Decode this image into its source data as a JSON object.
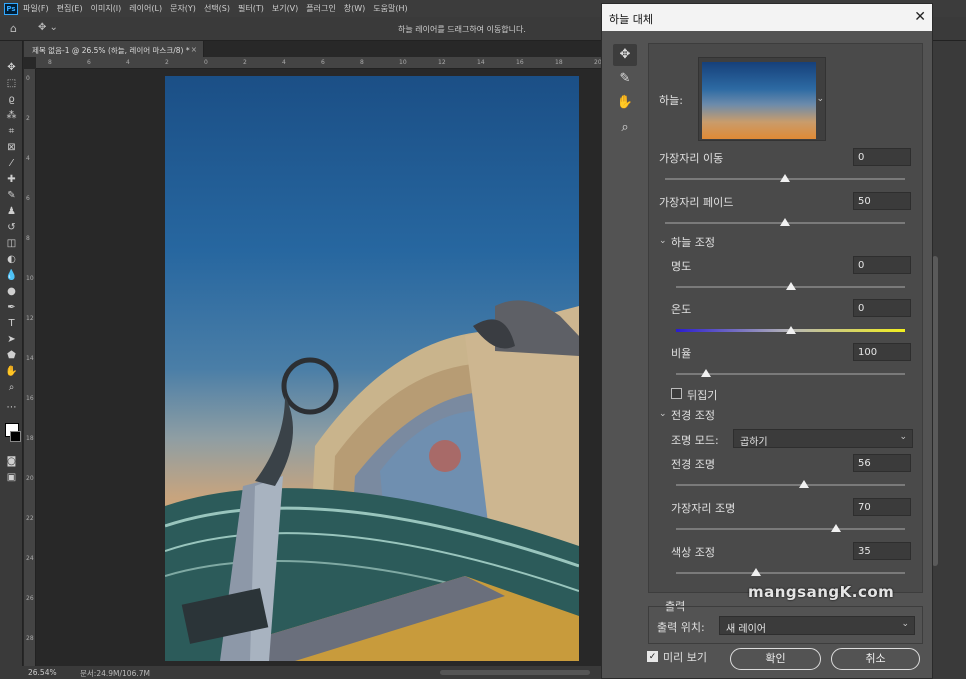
{
  "app": {
    "logo": "Ps"
  },
  "menu": [
    "파일(F)",
    "편집(E)",
    "이미지(I)",
    "레이어(L)",
    "문자(Y)",
    "선택(S)",
    "필터(T)",
    "보기(V)",
    "플러그인",
    "창(W)",
    "도움말(H)"
  ],
  "options_bar": {
    "hint": "하늘 레이어를 드래그하여 이동합니다."
  },
  "document": {
    "tab_title": "제목 없음-1 @ 26.5% (하늘, 레이어 마스크/8) *",
    "close": "×"
  },
  "ruler_h": [
    "8",
    "6",
    "4",
    "2",
    "0",
    "2",
    "4",
    "6",
    "8",
    "10",
    "12",
    "14",
    "16",
    "18",
    "20"
  ],
  "ruler_v": [
    "0",
    "2",
    "4",
    "6",
    "8",
    "10",
    "12",
    "14",
    "16",
    "18",
    "20",
    "22",
    "24",
    "26",
    "28"
  ],
  "status": {
    "zoom": "26.54%",
    "doc": "문서:24.9M/106.7M"
  },
  "dialog": {
    "title": "하늘 대체",
    "close": "✕",
    "tools": [
      "move-icon",
      "brush-icon",
      "hand-icon",
      "zoom-icon"
    ],
    "sky_label": "하늘:",
    "edge_shift": {
      "label": "가장자리 이동",
      "value": "0",
      "level": 0.5
    },
    "fade_edge": {
      "label": "가장자리 페이드",
      "value": "50",
      "level": 0.5
    },
    "sky_adjust": {
      "label": "하늘 조정"
    },
    "brightness": {
      "label": "명도",
      "value": "0",
      "level": 0.5
    },
    "temperature": {
      "label": "온도",
      "value": "0",
      "level": 0.5
    },
    "scale": {
      "label": "비율",
      "value": "100",
      "level": 0.13
    },
    "flip": {
      "label": "뒤집기",
      "checked": false
    },
    "fg_adjust": {
      "label": "전경 조정"
    },
    "light_mode": {
      "label": "조명 모드:",
      "value": "곱하기"
    },
    "fg_lighting": {
      "label": "전경 조명",
      "value": "56",
      "level": 0.56
    },
    "edge_lighting": {
      "label": "가장자리 조명",
      "value": "70",
      "level": 0.7
    },
    "color_adjust": {
      "label": "색상 조정",
      "value": "35",
      "level": 0.35
    },
    "output": {
      "label": "출력",
      "to_label": "출력 위치:",
      "to_value": "새 레이어"
    },
    "preview": {
      "label": "미리 보기",
      "checked": true
    },
    "ok": "확인",
    "cancel": "취소"
  },
  "watermark": "mangsangK.com"
}
